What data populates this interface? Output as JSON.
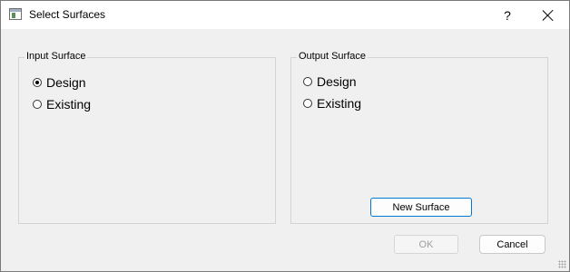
{
  "window": {
    "title": "Select Surfaces",
    "help_label": "?",
    "icons": {
      "app": "window-app-icon",
      "help": "question-mark-icon",
      "close": "close-x-icon"
    }
  },
  "input_group": {
    "label": "Input Surface",
    "options": [
      {
        "label": "Design",
        "checked": true
      },
      {
        "label": "Existing",
        "checked": false
      }
    ]
  },
  "output_group": {
    "label": "Output Surface",
    "options": [
      {
        "label": "Design",
        "checked": false
      },
      {
        "label": "Existing",
        "checked": false
      }
    ],
    "new_surface_label": "New Surface"
  },
  "footer": {
    "ok_label": "OK",
    "ok_enabled": false,
    "cancel_label": "Cancel"
  },
  "colors": {
    "dialog_bg": "#f0f0f0",
    "titlebar_bg": "#ffffff",
    "focus_border": "#0078d4"
  }
}
